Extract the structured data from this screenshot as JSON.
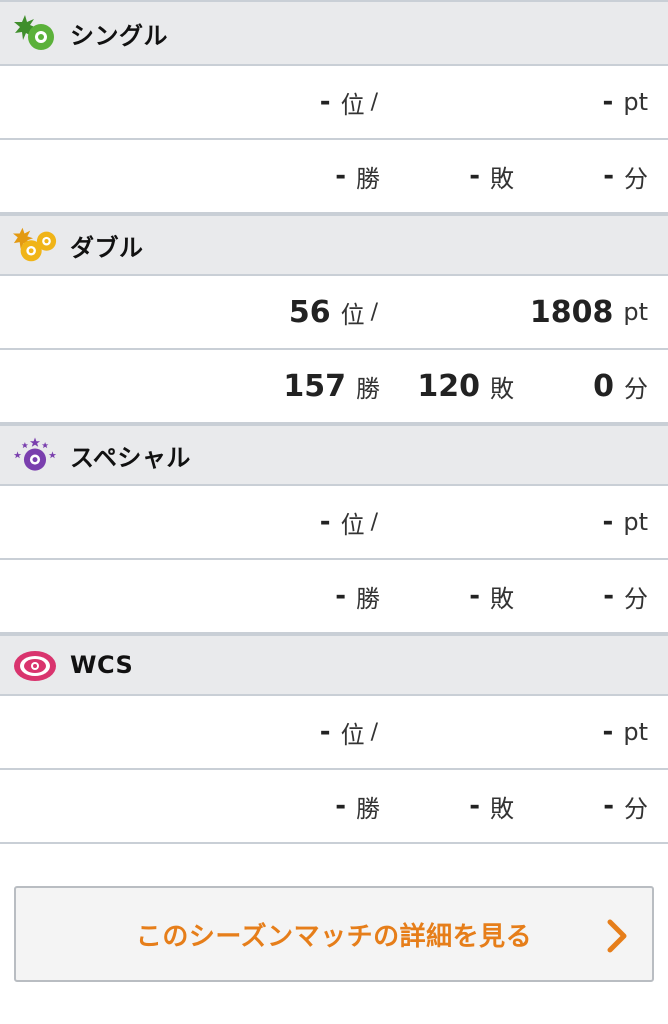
{
  "sections": [
    {
      "key": "single",
      "title": "シングル",
      "rank": "-",
      "rank_unit": "位",
      "slash": "/",
      "pt": "-",
      "pt_unit": "pt",
      "wins": "-",
      "win_unit": "勝",
      "losses": "-",
      "loss_unit": "敗",
      "draws": "-",
      "draw_unit": "分",
      "accent": "#5bb13a"
    },
    {
      "key": "double",
      "title": "ダブル",
      "rank": "56",
      "rank_unit": "位",
      "slash": "/",
      "pt": "1808",
      "pt_unit": "pt",
      "wins": "157",
      "win_unit": "勝",
      "losses": "120",
      "loss_unit": "敗",
      "draws": "0",
      "draw_unit": "分",
      "accent": "#f0b418"
    },
    {
      "key": "special",
      "title": "スペシャル",
      "rank": "-",
      "rank_unit": "位",
      "slash": "/",
      "pt": "-",
      "pt_unit": "pt",
      "wins": "-",
      "win_unit": "勝",
      "losses": "-",
      "loss_unit": "敗",
      "draws": "-",
      "draw_unit": "分",
      "accent": "#7a3fae"
    },
    {
      "key": "wcs",
      "title": "WCS",
      "rank": "-",
      "rank_unit": "位",
      "slash": "/",
      "pt": "-",
      "pt_unit": "pt",
      "wins": "-",
      "win_unit": "勝",
      "losses": "-",
      "loss_unit": "敗",
      "draws": "-",
      "draw_unit": "分",
      "accent": "#d9346e"
    }
  ],
  "detail_button": {
    "label": "このシーズンマッチの詳細を見る",
    "color": "#e67e1a"
  },
  "icons": {
    "single": "single-battle-icon",
    "double": "double-battle-icon",
    "special": "special-battle-icon",
    "wcs": "wcs-icon",
    "chevron": "chevron-right-icon"
  }
}
